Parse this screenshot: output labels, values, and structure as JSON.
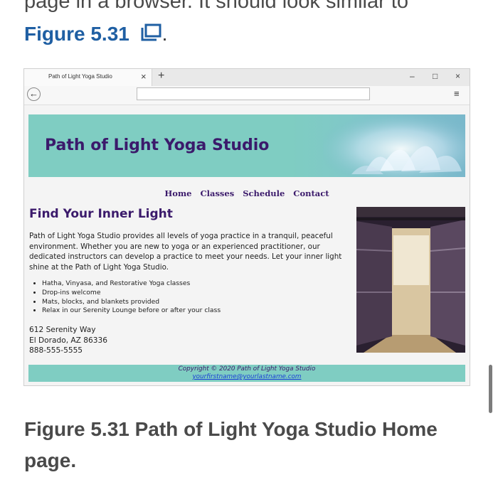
{
  "intro_text": "page in a browser. It should look similar to",
  "figure_link": {
    "label": "Figure 5.31",
    "icon": "external-link-icon",
    "trailing": "."
  },
  "browser": {
    "tab_title": "Path of Light Yoga Studio",
    "tab_close": "×",
    "new_tab": "+",
    "minimize": "–",
    "maximize": "□",
    "close": "×",
    "back": "←",
    "address_value": "",
    "menu": "≡"
  },
  "site": {
    "banner_title": "Path of Light Yoga Studio",
    "nav": [
      "Home",
      "Classes",
      "Schedule",
      "Contact"
    ],
    "heading": "Find Your Inner Light",
    "intro": "Path of Light Yoga Studio provides all levels of yoga practice in a tranquil, peaceful environment. Whether you are new to yoga or an experienced practitioner, our dedicated instructors can develop a practice to meet your needs. Let your inner light shine at the Path of Light Yoga Studio.",
    "features": [
      "Hatha, Vinyasa, and Restorative Yoga classes",
      "Drop-ins welcome",
      "Mats, blocks, and blankets provided",
      "Relax in our Serenity Lounge before or after your class"
    ],
    "address": [
      "612 Serenity Way",
      "El Dorado, AZ 86336",
      "888-555-5555"
    ],
    "footer_copyright": "Copyright © 2020 Path of Light Yoga Studio",
    "footer_email": "yourfirstname@yourlastname.com"
  },
  "caption": "Figure 5.31 Path of Light Yoga Studio Home page.",
  "colors": {
    "link": "#1f5fa3",
    "brand_purple": "#3b1a6b",
    "teal": "#7fcdc2"
  }
}
